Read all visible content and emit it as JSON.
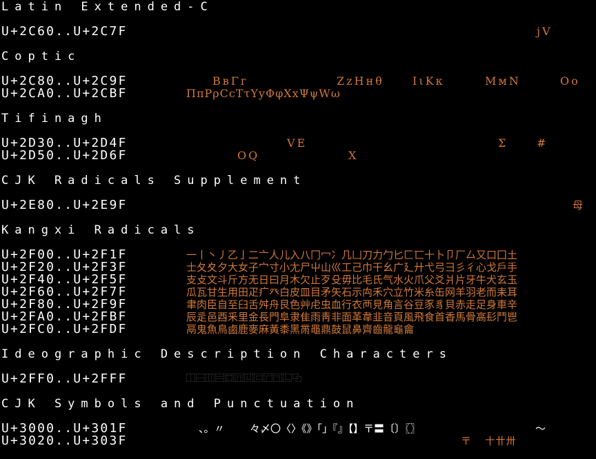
{
  "sections": {
    "latin_ext_c": {
      "header": "Latin Extended-C",
      "rows": [
        {
          "range": "U+2C60..U+2C7F",
          "glyphs": "jV"
        }
      ]
    },
    "coptic": {
      "header": "Coptic",
      "rows": [
        {
          "range": "U+2C80..U+2C9F",
          "glyphs_a": "ΒвΓг",
          "glyphs_b": "ZzHнθ",
          "glyphs_c": "IιKк",
          "glyphs_d": "MмN",
          "glyphs_e": "Oo"
        },
        {
          "range": "U+2CA0..U+2CBF",
          "glyphs": "ΠπPρCcTτYyΦφXxΨψWω"
        }
      ]
    },
    "tifinagh": {
      "header": "Tifinagh",
      "rows": [
        {
          "range": "U+2D30..U+2D4F",
          "glyphs_a": "VE",
          "glyphs_b": "Σ",
          "glyphs_c": "#"
        },
        {
          "range": "U+2D50..U+2D6F",
          "glyphs_a": "OQ",
          "glyphs_b": "X"
        }
      ]
    },
    "cjk_radicals_supplement": {
      "header": "CJK Radicals Supplement",
      "rows": [
        {
          "range": "U+2E80..U+2E9F",
          "glyphs": "母"
        }
      ]
    },
    "kangxi_radicals": {
      "header": "Kangxi Radicals",
      "rows": [
        {
          "range": "U+2F00..U+2F1F",
          "glyphs": "一丨丶丿乙亅二亠人儿入八冂冖冫几凵刀力勹匕匚匸十卜卩厂厶又口囗土"
        },
        {
          "range": "U+2F20..U+2F3F",
          "glyphs": "士夂夊夕大女子宀寸小尢尸屮山巛工己巾干幺广廴廾弋弓彐彡彳心戈戶手"
        },
        {
          "range": "U+2F40..U+2F5F",
          "glyphs": "支攴文斗斤方无日曰月木欠止歹殳毋比毛氏气水火爪父爻爿片牙牛犬玄玉"
        },
        {
          "range": "U+2F60..U+2F7F",
          "glyphs": "瓜瓦甘生用田疋疒癶白皮皿目矛矢石示禸禾穴立竹米糸缶网羊羽老而耒耳"
        },
        {
          "range": "U+2F80..U+2F9F",
          "glyphs": "聿肉臣自至臼舌舛舟艮色艸虍虫血行衣襾見角言谷豆豕豸貝赤走足身車辛"
        },
        {
          "range": "U+2FA0..U+2FBF",
          "glyphs": "辰辵邑酉釆里金長門阜隶隹雨靑非面革韋韭音頁風飛食首香馬骨高髟鬥鬯"
        },
        {
          "range": "U+2FC0..U+2FDF",
          "glyphs": "鬲鬼魚鳥鹵鹿麥麻黃黍黑黹黽鼎鼓鼠鼻齊齒龍龜龠"
        }
      ]
    },
    "ideographic_description": {
      "header": "Ideographic Description Characters",
      "rows": [
        {
          "range": "U+2FF0..U+2FFF",
          "glyphs": "⿰⿱⿲⿳⿴⿵⿶⿷⿸⿹⿺⿻"
        }
      ]
    },
    "cjk_symbols": {
      "header": "CJK Symbols and Punctuation",
      "rows": [
        {
          "range": "U+3000..U+301F",
          "glyphs_a": "、。〃",
          "glyphs_b": "々〆〇〈〉《》「」『』【】〒〓〔〕〖〗",
          "glyphs_c": "〜"
        },
        {
          "range": "U+3020..U+303F",
          "glyphs_a": "〒",
          "glyphs_b": "〸〹〺"
        }
      ]
    }
  }
}
